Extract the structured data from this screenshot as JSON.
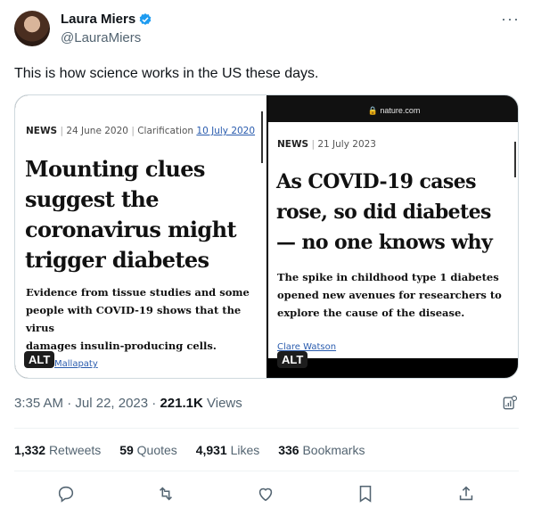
{
  "author": {
    "name": "Laura Miers",
    "handle": "@LauraMiers",
    "verified": true
  },
  "tweet": {
    "text": "This is how science works in the US these days."
  },
  "media": {
    "left": {
      "source": "NEWS",
      "date": "24 June 2020",
      "clarification_label": "Clarification",
      "clarification_date": "10 July 2020",
      "headline": [
        "Mounting clues",
        "suggest the",
        "coronavirus might",
        "trigger diabetes"
      ],
      "standfirst": [
        "Evidence from tissue studies and some",
        "people with COVID-19 shows that the virus",
        "damages insulin-producing cells."
      ],
      "byline": "Mallapaty",
      "alt_badge": "ALT"
    },
    "right": {
      "url": "nature.com",
      "source": "NEWS",
      "date": "21 July 2023",
      "headline": [
        "As COVID-19 cases",
        "rose, so did diabetes",
        "— no one knows why"
      ],
      "standfirst": [
        "The spike in childhood type 1 diabetes",
        "opened new avenues for researchers to",
        "explore the cause of the disease."
      ],
      "byline": "Clare Watson",
      "alt_badge": "ALT"
    }
  },
  "timestamp": {
    "time": "3:35 AM",
    "sep": "·",
    "date": "Jul 22, 2023",
    "views_count": "221.1K",
    "views_label": "Views"
  },
  "stats": {
    "retweets": {
      "count": "1,332",
      "label": "Retweets"
    },
    "quotes": {
      "count": "59",
      "label": "Quotes"
    },
    "likes": {
      "count": "4,931",
      "label": "Likes"
    },
    "bookmarks": {
      "count": "336",
      "label": "Bookmarks"
    }
  },
  "icons": [
    "verified-badge-icon",
    "more-icon",
    "analytics-icon",
    "reply-icon",
    "retweet-icon",
    "like-icon",
    "bookmark-icon",
    "share-icon"
  ],
  "colors": {
    "verified": "#1d9bf0",
    "secondary_text": "#536471",
    "link": "#2a5cae"
  }
}
